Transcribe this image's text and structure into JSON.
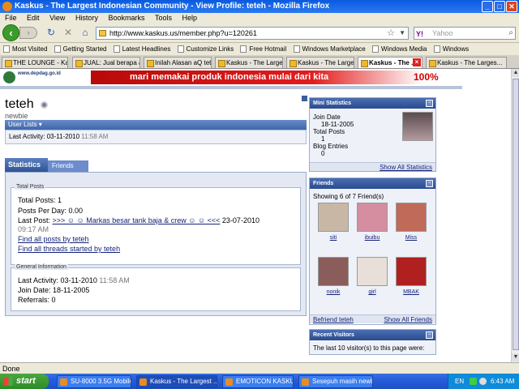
{
  "window": {
    "title": "Kaskus - The Largest Indonesian Community - View Profile: teteh - Mozilla Firefox"
  },
  "menu": [
    "File",
    "Edit",
    "View",
    "History",
    "Bookmarks",
    "Tools",
    "Help"
  ],
  "nav": {
    "url": "http://www.kaskus.us/member.php?u=120261",
    "search_placeholder": "Yahoo"
  },
  "bookmarks": [
    "Most Visited",
    "Getting Started",
    "Latest Headlines",
    "Customize Links",
    "Free Hotmail",
    "Windows Marketplace",
    "Windows Media",
    "Windows"
  ],
  "tabs": [
    {
      "label": "THE LOUNGE - Kask..."
    },
    {
      "label": "JUAL: Jual berapa a..."
    },
    {
      "label": "Inilah Alasan aQ tet..."
    },
    {
      "label": "Kaskus - The Larges..."
    },
    {
      "label": "Kaskus - The Larges..."
    },
    {
      "label": "Kaskus - The ..."
    },
    {
      "label": "Kaskus - The Larges..."
    }
  ],
  "banner": {
    "logo_text": "www.depdag.go.id",
    "slogan": "mari memakai produk indonesia mulai dari kita",
    "badge": "100%"
  },
  "profile": {
    "username": "teteh",
    "title": "newbie",
    "user_lists": "User Lists",
    "last_activity_label": "Last Activity:",
    "last_activity_date": "03-11-2010",
    "last_activity_time": "11:58 AM"
  },
  "tabs_profile": {
    "statistics": "Statistics",
    "friends": "Friends"
  },
  "total_posts": {
    "legend": "Total Posts",
    "total_posts": "Total Posts: 1",
    "posts_per_day": "Posts Per Day: 0.00",
    "last_post_label": "Last Post:",
    "last_post_link": ">>> ☺ ☺ Markas besar tank baja & crew ☺ ☺ <<<",
    "last_post_date": "23-07-2010",
    "last_post_time": "09:17 AM",
    "find_posts": "Find all posts by teteh",
    "find_threads": "Find all threads started by teteh"
  },
  "general_info": {
    "legend": "General Information",
    "last_activity": "Last Activity: 03-11-2010",
    "last_activity_time": "11:58 AM",
    "join_date": "Join Date: 18-11-2005",
    "referrals": "Referrals: 0"
  },
  "mini_stats": {
    "header": "Mini Statistics",
    "join_label": "Join Date",
    "join_value": "18-11-2005",
    "posts_label": "Total Posts",
    "posts_value": "1",
    "blog_label": "Blog Entries",
    "blog_value": "0",
    "show_all": "Show All Statistics"
  },
  "friends": {
    "header": "Friends",
    "showing": "Showing 6 of 7 Friend(s)",
    "list": [
      {
        "name": "siti",
        "color": "#c9b7a6"
      },
      {
        "name": "ibuibu",
        "color": "#d48ea0"
      },
      {
        "name": "Miss",
        "color": "#c06a5a"
      },
      {
        "name": "nonik",
        "color": "#8a5d5a"
      },
      {
        "name": "girl",
        "color": "#e8e0d8"
      },
      {
        "name": "MBAK",
        "color": "#b02020"
      }
    ],
    "befriend": "Befriend teteh",
    "show_all": "Show All Friends"
  },
  "visitors": {
    "header": "Recent Visitors",
    "text": "The last 10 visitor(s) to this page were:"
  },
  "status": "Done",
  "taskbar": {
    "start": "start",
    "items": [
      "SU-8000 3.5G Mobile ...",
      "Kaskus - The Largest ...",
      "EMOTICON KASKUS - ...",
      "Sesepuh masih newbi..."
    ],
    "lang": "EN",
    "clock": "6:43 AM"
  }
}
